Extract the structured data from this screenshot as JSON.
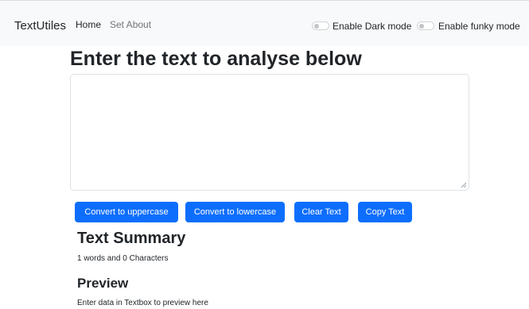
{
  "navbar": {
    "brand": "TextUtiles",
    "links": [
      {
        "label": "Home"
      },
      {
        "label": "Set About"
      }
    ],
    "toggles": [
      {
        "label": "Enable Dark mode",
        "checked": false
      },
      {
        "label": "Enable funky mode",
        "checked": false
      }
    ]
  },
  "main": {
    "heading": "Enter the text to analyse below",
    "textarea_value": "",
    "buttons": {
      "uppercase": "Convert to uppercase",
      "lowercase": "Convert to lowercase",
      "clear": "Clear Text",
      "copy": "Copy Text"
    },
    "summary": {
      "title": "Text Summary",
      "text": "1 words and 0 Characters"
    },
    "preview": {
      "title": "Preview",
      "text": "Enter data in Textbox to preview here"
    }
  },
  "colors": {
    "primary": "#0d6efd",
    "navbar_bg": "#f8f9fa"
  }
}
